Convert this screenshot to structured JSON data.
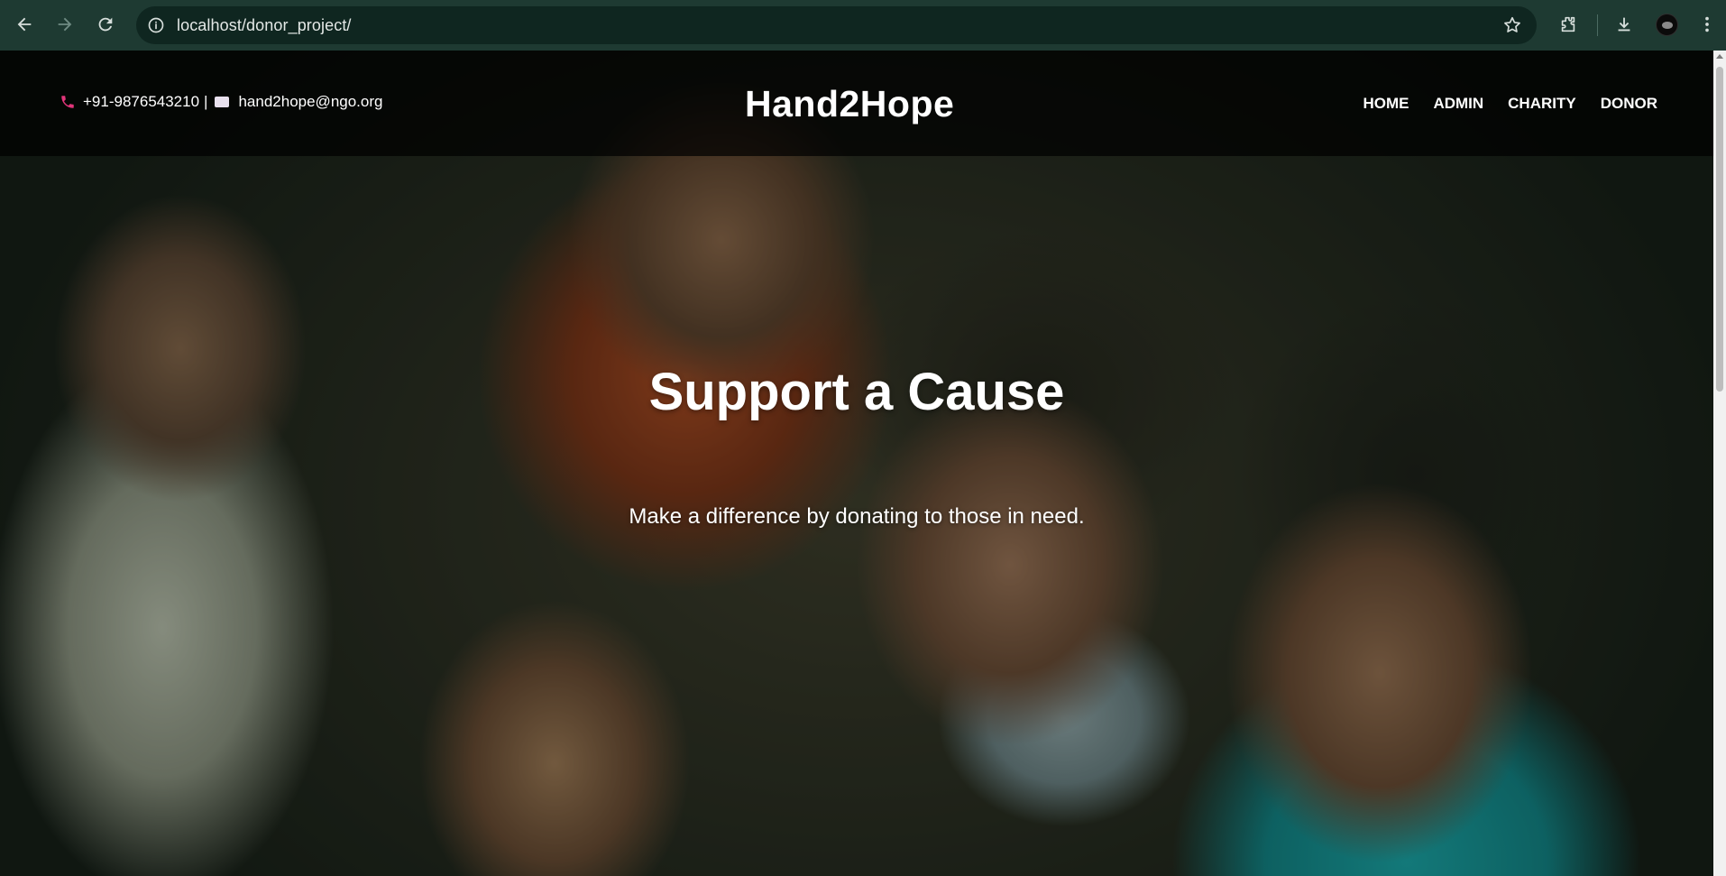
{
  "browser": {
    "url": "localhost/donor_project/"
  },
  "header": {
    "phone": "+91-9876543210",
    "separator": "|",
    "email": "hand2hope@ngo.org",
    "brand": "Hand2Hope",
    "nav": [
      "HOME",
      "ADMIN",
      "CHARITY",
      "DONOR"
    ]
  },
  "hero": {
    "title": "Support a Cause",
    "subtitle": "Make a difference by donating to those in need."
  },
  "icons": {
    "phone": "phone-icon",
    "email": "envelope-icon"
  },
  "colors": {
    "phone_icon": "#e0357a",
    "header_bg": "rgba(0,0,0,0.72)",
    "chrome_bg": "#1e3a32"
  }
}
